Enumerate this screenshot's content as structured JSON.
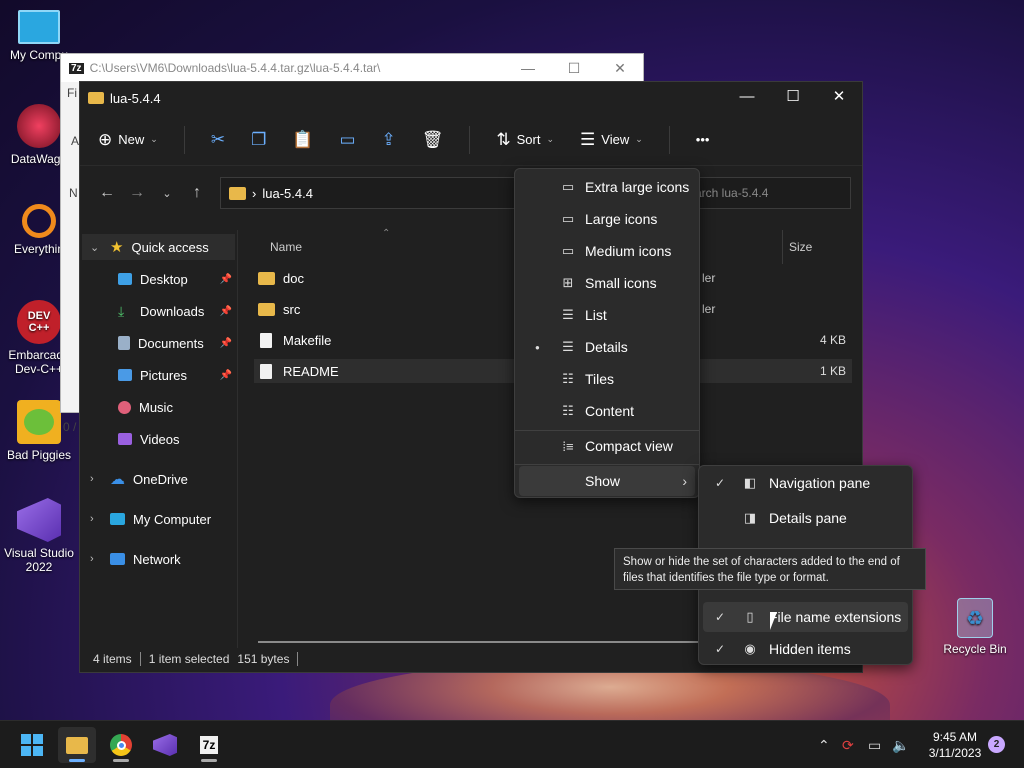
{
  "desktop": {
    "icons": [
      {
        "label": "My Compu",
        "color": "#2aa7e0"
      },
      {
        "label": "DataWago",
        "color": "#d0204a"
      },
      {
        "label": "Everythin",
        "color": "#f08a1c"
      },
      {
        "label": "Embarcade Dev-C++",
        "color": "#c0202a"
      },
      {
        "label": "Bad Piggies",
        "color": "#6cbf3a"
      },
      {
        "label": "Visual Studio 2022",
        "color": "#7a4fd0"
      },
      {
        "label": "Recycle Bin",
        "color": "#6ab4e0"
      }
    ]
  },
  "bg_window": {
    "logo": "7z",
    "title": "C:\\Users\\VM6\\Downloads\\lua-5.4.4.tar.gz\\lua-5.4.4.tar\\",
    "min": "—",
    "max": "☐",
    "close": "✕",
    "side_fragments": [
      "Fi",
      "A",
      "N",
      "0 /"
    ]
  },
  "explorer": {
    "title": "lua-5.4.4",
    "min": "—",
    "max": "☐",
    "close": "✕",
    "toolbar": {
      "new_label": "New",
      "sort_label": "Sort",
      "view_label": "View",
      "more": "•••"
    },
    "address": {
      "path": "lua-5.4.4",
      "chevron": "›"
    },
    "search": {
      "placeholder": "arch lua-5.4.4"
    },
    "nav": {
      "quick_access": "Quick access",
      "items": [
        {
          "label": "Desktop",
          "color": "#3ea0e6"
        },
        {
          "label": "Downloads",
          "color": "#4fc26b"
        },
        {
          "label": "Documents",
          "color": "#9ab0c8"
        },
        {
          "label": "Pictures",
          "color": "#4a9ae6"
        },
        {
          "label": "Music",
          "color": "#e0607a"
        },
        {
          "label": "Videos",
          "color": "#9a60e0"
        }
      ],
      "onedrive": "OneDrive",
      "my_computer": "My Computer",
      "network": "Network"
    },
    "columns": {
      "name": "Name",
      "size": "Size"
    },
    "files": [
      {
        "name": "doc",
        "type": "folder",
        "partial": "ler",
        "size": ""
      },
      {
        "name": "src",
        "type": "folder",
        "partial": "ler",
        "size": ""
      },
      {
        "name": "Makefile",
        "type": "file",
        "partial": "",
        "size": "4 KB"
      },
      {
        "name": "README",
        "type": "file",
        "partial": "",
        "size": "1 KB"
      }
    ],
    "status": {
      "items": "4 items",
      "selected": "1 item selected",
      "size": "151 bytes"
    }
  },
  "view_menu": {
    "items": [
      {
        "label": "Extra large icons",
        "icon": "▭",
        "selected": false
      },
      {
        "label": "Large icons",
        "icon": "▭",
        "selected": false
      },
      {
        "label": "Medium icons",
        "icon": "▭",
        "selected": false
      },
      {
        "label": "Small icons",
        "icon": "⊞",
        "selected": false
      },
      {
        "label": "List",
        "icon": "☰",
        "selected": false
      },
      {
        "label": "Details",
        "icon": "☰",
        "selected": true
      },
      {
        "label": "Tiles",
        "icon": "☷",
        "selected": false
      },
      {
        "label": "Content",
        "icon": "☷",
        "selected": false
      }
    ],
    "compact": "Compact view",
    "show": "Show",
    "bullet": "●",
    "arrow": "›"
  },
  "show_menu": {
    "items": [
      {
        "label": "Navigation pane",
        "checked": true
      },
      {
        "label": "Details pane",
        "checked": false
      },
      {
        "label": "File name extensions",
        "checked": true
      },
      {
        "label": "Hidden items",
        "checked": true
      }
    ],
    "check": "✓"
  },
  "tooltip": {
    "text": "Show or hide the set of characters added to the end of files that identifies the file type or format."
  },
  "taskbar": {
    "time": "9:45 AM",
    "date": "3/11/2023",
    "notifications": "2",
    "sevenzip": "7z"
  }
}
